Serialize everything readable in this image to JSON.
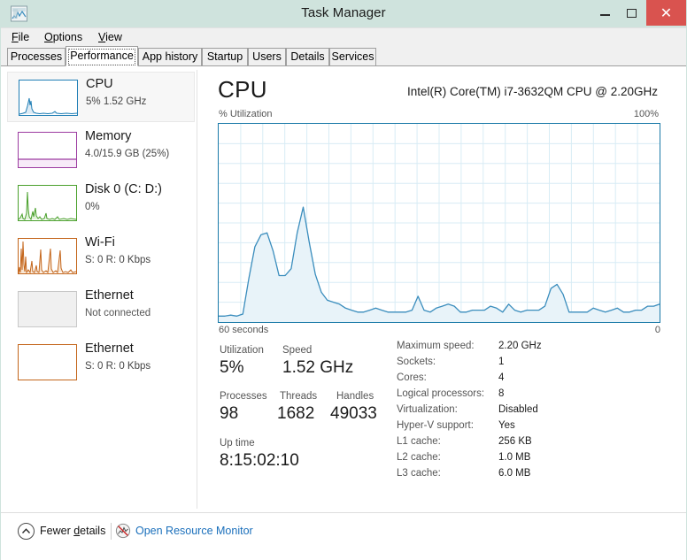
{
  "window": {
    "title": "Task Manager",
    "icon": "task-manager-icon",
    "controls": {
      "minimize": "–",
      "maximize": "□",
      "close": "✕"
    },
    "close_color": "#d9534f",
    "titlebar_color": "#cfe3dd"
  },
  "menu": [
    {
      "label": "File",
      "accel": "F"
    },
    {
      "label": "Options",
      "accel": "O"
    },
    {
      "label": "View",
      "accel": "V"
    }
  ],
  "tabs": [
    {
      "label": "Processes",
      "selected": false
    },
    {
      "label": "Performance",
      "selected": true
    },
    {
      "label": "App history",
      "selected": false
    },
    {
      "label": "Startup",
      "selected": false
    },
    {
      "label": "Users",
      "selected": false
    },
    {
      "label": "Details",
      "selected": false
    },
    {
      "label": "Services",
      "selected": false
    }
  ],
  "sidebar": {
    "items": [
      {
        "title": "CPU",
        "subtitle": "5%  1.52 GHz",
        "selected": true,
        "color": "#1f7eb5",
        "fill": "#dceaf4",
        "thumb": "cpu-thumbnail-graph"
      },
      {
        "title": "Memory",
        "subtitle": "4.0/15.9 GB (25%)",
        "selected": false,
        "color": "#9c3ba0",
        "fill": "#f2e2f3",
        "thumb": "memory-thumbnail-graph"
      },
      {
        "title": "Disk 0 (C: D:)",
        "subtitle": "0%",
        "selected": false,
        "color": "#4aa02c",
        "fill": "#e4f3dd",
        "thumb": "disk-thumbnail-graph"
      },
      {
        "title": "Wi-Fi",
        "subtitle": "S: 0 R: 0 Kbps",
        "selected": false,
        "color": "#c4651a",
        "fill": "#f8e6d4",
        "thumb": "wifi-thumbnail-graph"
      },
      {
        "title": "Ethernet",
        "subtitle": "Not connected",
        "selected": false,
        "color": "#b0b0b0",
        "fill": "#f0f0f0",
        "thumb": "ethernet-disconnected-thumbnail"
      },
      {
        "title": "Ethernet",
        "subtitle": "S: 0 R: 0 Kbps",
        "selected": false,
        "color": "#c4651a",
        "fill": "#ffffff",
        "thumb": "ethernet-thumbnail-graph"
      }
    ]
  },
  "main": {
    "heading": "CPU",
    "model": "Intel(R) Core(TM) i7-3632QM CPU @ 2.20GHz",
    "graph": {
      "y_axis_label": "% Utilization",
      "y_max_label": "100%",
      "x_left_label": "60 seconds",
      "x_right_label": "0",
      "line_color": "#3a8dbd",
      "fill_color": "#e8f3f9",
      "border_color": "#1a7aa8",
      "grid_color": "#d8ecf5"
    },
    "stats": [
      {
        "label": "Utilization",
        "value": "5%"
      },
      {
        "label": "Speed",
        "value": "1.52 GHz"
      },
      {
        "label": "Processes",
        "value": "98"
      },
      {
        "label": "Threads",
        "value": "1682"
      },
      {
        "label": "Handles",
        "value": "49033"
      },
      {
        "label": "Up time",
        "value": "8:15:02:10"
      }
    ],
    "specs": [
      {
        "key": "Maximum speed:",
        "value": "2.20 GHz"
      },
      {
        "key": "Sockets:",
        "value": "1"
      },
      {
        "key": "Cores:",
        "value": "4"
      },
      {
        "key": "Logical processors:",
        "value": "8"
      },
      {
        "key": "Virtualization:",
        "value": "Disabled"
      },
      {
        "key": "Hyper-V support:",
        "value": "Yes"
      },
      {
        "key": "L1 cache:",
        "value": "256 KB"
      },
      {
        "key": "L2 cache:",
        "value": "1.0 MB"
      },
      {
        "key": "L3 cache:",
        "value": "6.0 MB"
      }
    ]
  },
  "statusbar": {
    "fewer_details": "Fewer details",
    "fewer_details_accel": "d",
    "resource_monitor": "Open Resource Monitor",
    "link_color": "#1a6fbb"
  },
  "chart_data": {
    "type": "area",
    "title": "% Utilization",
    "xlabel": "seconds",
    "ylabel": "% Utilization",
    "xlim": [
      60,
      0
    ],
    "ylim": [
      0,
      100
    ],
    "grid": true,
    "grid_cols": 20,
    "grid_rows": 10,
    "series": [
      {
        "name": "CPU utilization",
        "values": [
          3,
          3,
          3.5,
          3,
          4,
          22,
          38,
          44,
          45,
          36,
          32,
          32,
          36,
          45,
          58,
          40,
          24,
          15,
          11,
          10,
          9,
          7,
          6,
          5,
          5,
          6,
          7,
          6,
          5,
          5,
          5,
          5,
          6,
          13,
          6,
          5,
          7,
          8,
          9,
          8,
          5,
          5,
          6,
          6,
          6,
          8,
          7,
          5,
          9,
          6,
          5,
          6,
          6,
          6,
          8,
          17,
          19,
          14,
          5,
          5,
          5,
          5,
          7,
          6,
          5,
          6,
          7,
          5,
          5,
          6,
          6,
          7,
          7,
          8
        ]
      }
    ]
  }
}
